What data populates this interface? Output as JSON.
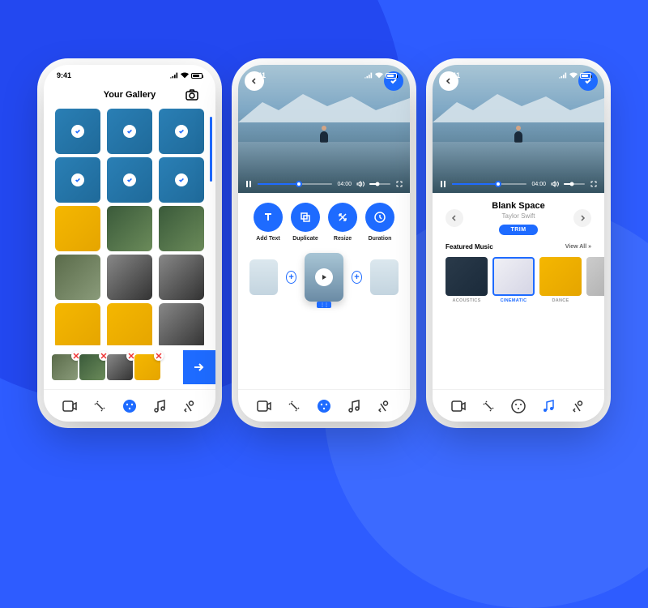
{
  "status_time": "9:41",
  "screen1": {
    "title": "Your Gallery"
  },
  "screen2": {
    "player": {
      "time": "04:00"
    },
    "actions": [
      {
        "label": "Add Text"
      },
      {
        "label": "Duplicate"
      },
      {
        "label": "Resize"
      },
      {
        "label": "Duration"
      }
    ]
  },
  "screen3": {
    "player": {
      "time": "04:00"
    },
    "song": {
      "title": "Blank Space",
      "artist": "Taylor Swift",
      "trim_label": "TRIM"
    },
    "featured": {
      "heading": "Featured Music",
      "view_all": "View All  »"
    },
    "categories": [
      {
        "label": "ACOUSTICS"
      },
      {
        "label": "CINEMATIC"
      },
      {
        "label": "DANCE"
      }
    ]
  }
}
